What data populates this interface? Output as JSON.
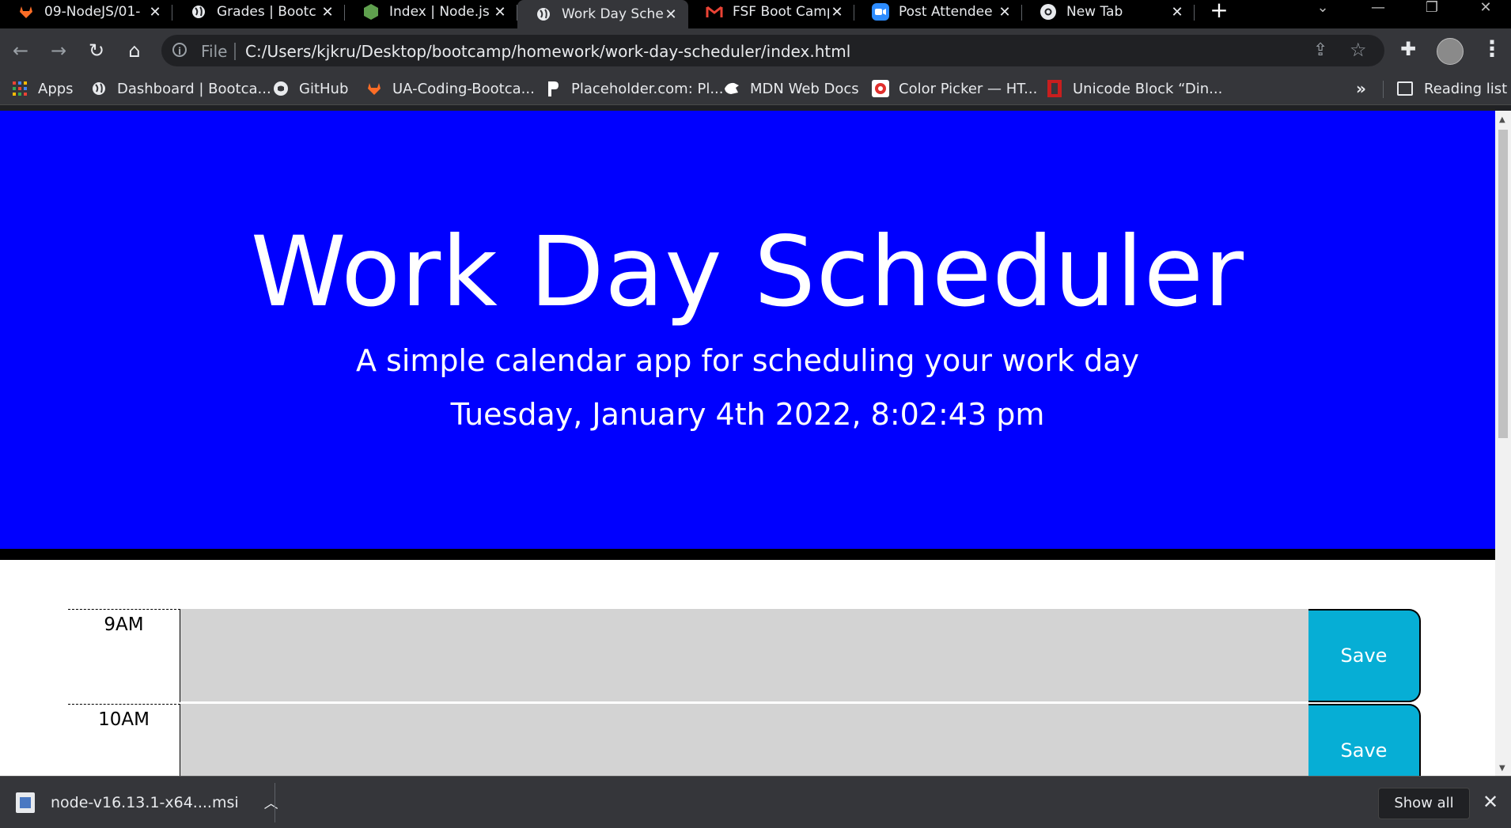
{
  "browser": {
    "tabs": [
      {
        "title": "09-NodeJS/01-",
        "icon": "gitlab-icon",
        "active": false
      },
      {
        "title": "Grades | Bootc",
        "icon": "globe-icon",
        "active": false
      },
      {
        "title": "Index | Node.js",
        "icon": "nodejs-icon",
        "active": false
      },
      {
        "title": "Work Day Sche",
        "icon": "globe-icon",
        "active": true
      },
      {
        "title": "FSF Boot Camp",
        "icon": "gmail-icon",
        "active": false
      },
      {
        "title": "Post Attendee",
        "icon": "zoom-icon",
        "active": false
      },
      {
        "title": "New Tab",
        "icon": "chrome-icon",
        "active": false
      }
    ],
    "address": {
      "scheme_label": "File",
      "url": "C:/Users/kjkru/Desktop/bootcamp/homework/work-day-scheduler/index.html"
    },
    "bookmarks": [
      {
        "label": "Apps",
        "icon": "apps-grid-icon"
      },
      {
        "label": "Dashboard | Bootca...",
        "icon": "globe-icon"
      },
      {
        "label": "GitHub",
        "icon": "github-icon"
      },
      {
        "label": "UA-Coding-Bootca...",
        "icon": "gitlab-icon"
      },
      {
        "label": "Placeholder.com: Pl...",
        "icon": "placeholder-icon"
      },
      {
        "label": "MDN Web Docs",
        "icon": "mdn-icon"
      },
      {
        "label": "Color Picker — HT...",
        "icon": "color-picker-icon"
      },
      {
        "label": "Unicode Block “Din...",
        "icon": "unicode-icon"
      }
    ],
    "bookmarks_overflow": "»",
    "reading_list": "Reading list",
    "colors": {
      "tab_strip": "#000000",
      "toolbar": "#35363a",
      "omnibox": "#202124"
    }
  },
  "page": {
    "title": "Work Day Scheduler",
    "lead": "A simple calendar app for scheduling your work day",
    "current_day": "Tuesday, January 4th 2022, 8:02:43 pm",
    "time_blocks": [
      {
        "hour": "9AM",
        "text": "",
        "save_label": "Save"
      },
      {
        "hour": "10AM",
        "text": "",
        "save_label": "Save"
      }
    ],
    "colors": {
      "jumbotron": "#0000ff",
      "time_block_past": "#d3d3d3",
      "save_button": "#06aed5"
    }
  },
  "downloads": {
    "file_name": "node-v16.13.1-x64....msi",
    "show_all": "Show all"
  }
}
